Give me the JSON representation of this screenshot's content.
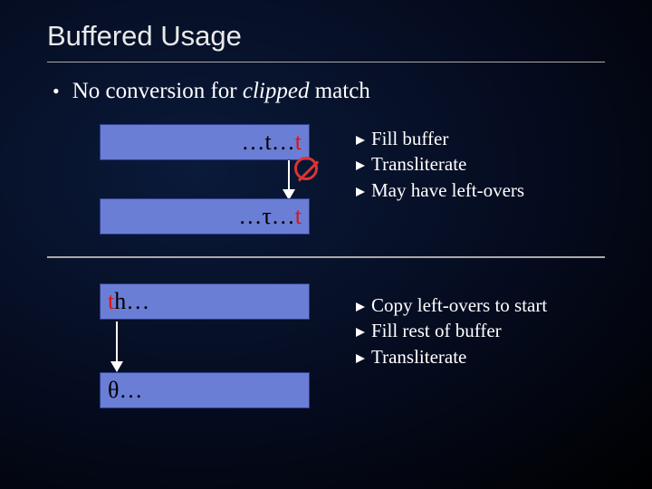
{
  "title": "Buffered Usage",
  "bullet": {
    "prefix": "No conversion for ",
    "clipped": "clipped",
    "suffix": " match"
  },
  "boxes": {
    "top": {
      "black": "…t…",
      "red": "t"
    },
    "second": {
      "black": "…τ…",
      "red": "t"
    },
    "third": {
      "red": "t",
      "black": "h…"
    },
    "fourth": {
      "black": "θ…"
    }
  },
  "right_top": {
    "items": [
      "Fill buffer",
      "Transliterate",
      "May have left-overs"
    ]
  },
  "right_bottom": {
    "items": [
      "Copy left-overs to start",
      "Fill rest of buffer",
      "Transliterate"
    ]
  }
}
